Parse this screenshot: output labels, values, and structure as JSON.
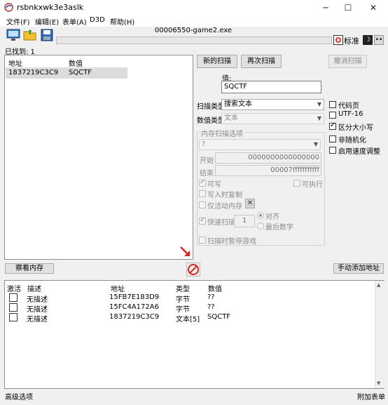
{
  "window": {
    "title": "rsbnkxwk3e3aslk",
    "minimize": "─",
    "maximize": "☐",
    "close": "✕"
  },
  "menu": [
    "文件(F)",
    "编辑(E)",
    "表单(A)",
    "D3D",
    "帮助(H)"
  ],
  "process_name": "00006550-game2.exe",
  "corner": {
    "label": "标准"
  },
  "found": {
    "label": "已找到: 1"
  },
  "results": {
    "headers": {
      "address": "地址",
      "value": "数值"
    },
    "rows": [
      {
        "address": "1837219C3C9",
        "value": "SQCTF"
      }
    ]
  },
  "buttons": {
    "new_scan": "新的扫描",
    "next_scan": "再次扫描",
    "undo_scan": "撤消扫描",
    "view_memory": "察看内存",
    "add_manual": "手动添加地址"
  },
  "scan": {
    "value_label": "值:",
    "value": "SQCTF",
    "scan_type_label": "扫描类型",
    "scan_type": "搜索文本",
    "value_type_label": "数值类型",
    "value_type": "文本"
  },
  "options": {
    "code_page": "代码页",
    "utf16": "UTF-16",
    "case_sensitive": "区分大小写",
    "no_random": "非随机化",
    "speedhack": "启用速度调整"
  },
  "mem": {
    "title": "内存扫描选项",
    "region": "?",
    "start_label": "开始",
    "start": "0000000000000000",
    "stop_label": "结束",
    "stop": "00007fffffffffff",
    "writable": "可写",
    "executable": "可执行",
    "copy_on_write": "写入时复制",
    "active_only": "仅活动内存",
    "fast_scan": "快速扫描",
    "fast_value": "1",
    "align": "对齐",
    "last_digits": "最后数字",
    "pause": "扫描时暂停游戏"
  },
  "table": {
    "headers": {
      "active": "激活",
      "desc": "描述",
      "address": "地址",
      "type": "类型",
      "value": "数值"
    },
    "rows": [
      {
        "desc": "无描述",
        "address": "15FB7E183D9",
        "type": "字节",
        "value": "??"
      },
      {
        "desc": "无描述",
        "address": "15FC4A172A6",
        "type": "字节",
        "value": "??"
      },
      {
        "desc": "无描述",
        "address": "1837219C3C9",
        "type": "文本[5]",
        "value": "SQCTF"
      }
    ]
  },
  "status": {
    "left": "高级选项",
    "right": "附加表单"
  }
}
